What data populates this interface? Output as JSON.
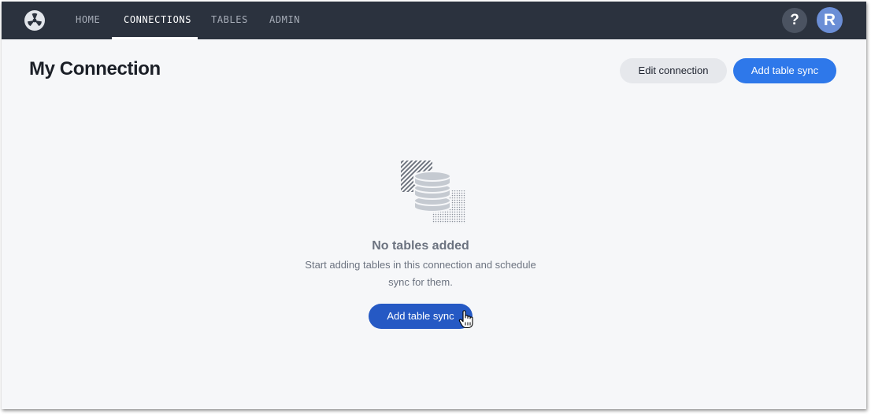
{
  "nav": {
    "items": [
      {
        "label": "HOME"
      },
      {
        "label": "CONNECTIONS"
      },
      {
        "label": "TABLES"
      },
      {
        "label": "ADMIN"
      }
    ],
    "active": "CONNECTIONS",
    "help_label": "?",
    "avatar_initial": "R",
    "logo_icon": "logo-icon"
  },
  "header": {
    "title": "My Connection",
    "edit_label": "Edit connection",
    "add_label": "Add table sync"
  },
  "empty_state": {
    "icon": "database-icon",
    "title": "No tables added",
    "description": "Start adding tables in this connection and schedule sync for them.",
    "button_label": "Add table sync"
  },
  "colors": {
    "topbar": "#2b323e",
    "primary": "#2e78ea",
    "primary_pressed": "#2559c4",
    "background": "#f6f7f9"
  }
}
